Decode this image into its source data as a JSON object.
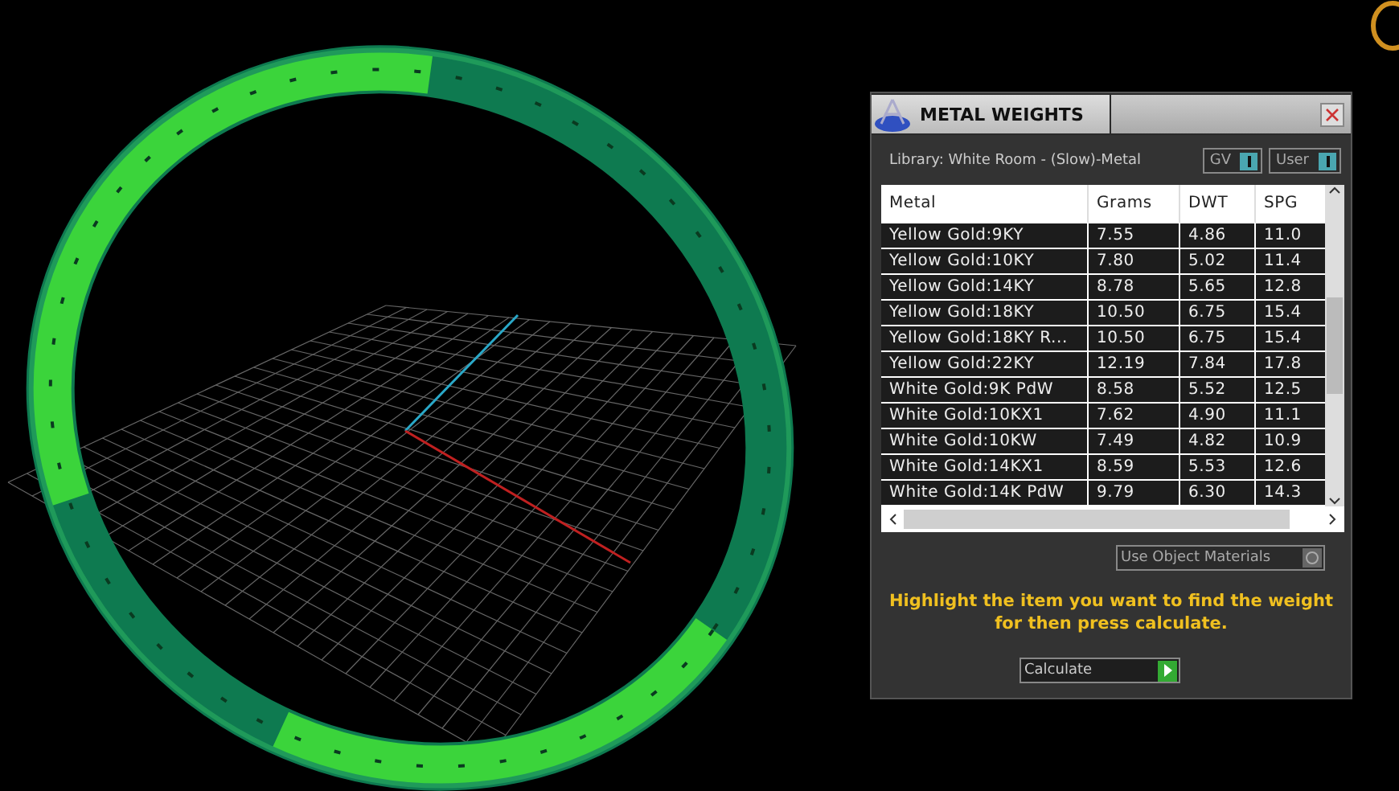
{
  "panel": {
    "title": "METAL WEIGHTS",
    "library": "Library: White Room - (Slow)-Metal",
    "toggles": [
      {
        "label": "GV",
        "on": true
      },
      {
        "label": "User",
        "on": true
      }
    ],
    "table": {
      "columns": [
        "Metal",
        "Grams",
        "DWT",
        "SPG"
      ],
      "rows": [
        [
          "Yellow Gold:9KY",
          "7.55",
          "4.86",
          "11.0"
        ],
        [
          "Yellow Gold:10KY",
          "7.80",
          "5.02",
          "11.4"
        ],
        [
          "Yellow Gold:14KY",
          "8.78",
          "5.65",
          "12.8"
        ],
        [
          "Yellow Gold:18KY",
          "10.50",
          "6.75",
          "15.4"
        ],
        [
          "Yellow Gold:18KY R...",
          "10.50",
          "6.75",
          "15.4"
        ],
        [
          "Yellow Gold:22KY",
          "12.19",
          "7.84",
          "17.8"
        ],
        [
          "White Gold:9K PdW",
          "8.58",
          "5.52",
          "12.5"
        ],
        [
          "White Gold:10KX1",
          "7.62",
          "4.90",
          "11.1"
        ],
        [
          "White Gold:10KW",
          "7.49",
          "4.82",
          "10.9"
        ],
        [
          "White Gold:14KX1",
          "8.59",
          "5.53",
          "12.6"
        ],
        [
          "White Gold:14K PdW",
          "9.79",
          "6.30",
          "14.3"
        ]
      ]
    },
    "use_object_materials": {
      "label": "Use Object Materials",
      "on": false
    },
    "instruction": "Highlight the item you want to find the weight for then press calculate.",
    "calculate_button": "Calculate"
  }
}
